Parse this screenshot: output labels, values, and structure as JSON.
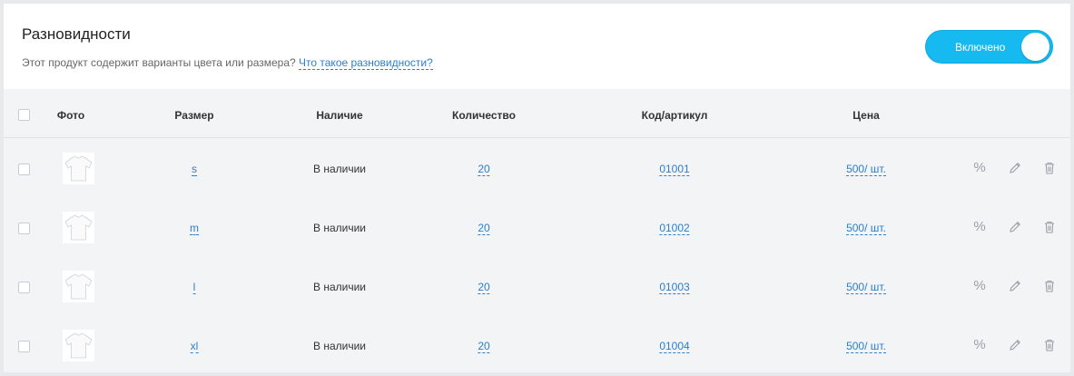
{
  "header": {
    "title": "Разновидности",
    "subtitle": "Этот продукт содержит варианты цвета или размера?",
    "help_link": "Что такое разновидности?",
    "toggle_label": "Включено"
  },
  "table": {
    "columns": {
      "photo": "Фото",
      "size": "Размер",
      "availability": "Наличие",
      "quantity": "Количество",
      "sku": "Код/артикул",
      "price": "Цена"
    },
    "rows": [
      {
        "size": "s",
        "availability": "В наличии",
        "quantity": "20",
        "sku": "01001",
        "price": "500/ шт."
      },
      {
        "size": "m",
        "availability": "В наличии",
        "quantity": "20",
        "sku": "01002",
        "price": "500/ шт."
      },
      {
        "size": "l",
        "availability": "В наличии",
        "quantity": "20",
        "sku": "01003",
        "price": "500/ шт."
      },
      {
        "size": "xl",
        "availability": "В наличии",
        "quantity": "20",
        "sku": "01004",
        "price": "500/ шт."
      }
    ],
    "actions": {
      "discount": "%"
    }
  },
  "icons": {
    "photo": "tshirt-icon",
    "edit": "pencil-icon",
    "delete": "trash-icon"
  },
  "colors": {
    "accent": "#17baf0",
    "link": "#2a7fd0"
  }
}
